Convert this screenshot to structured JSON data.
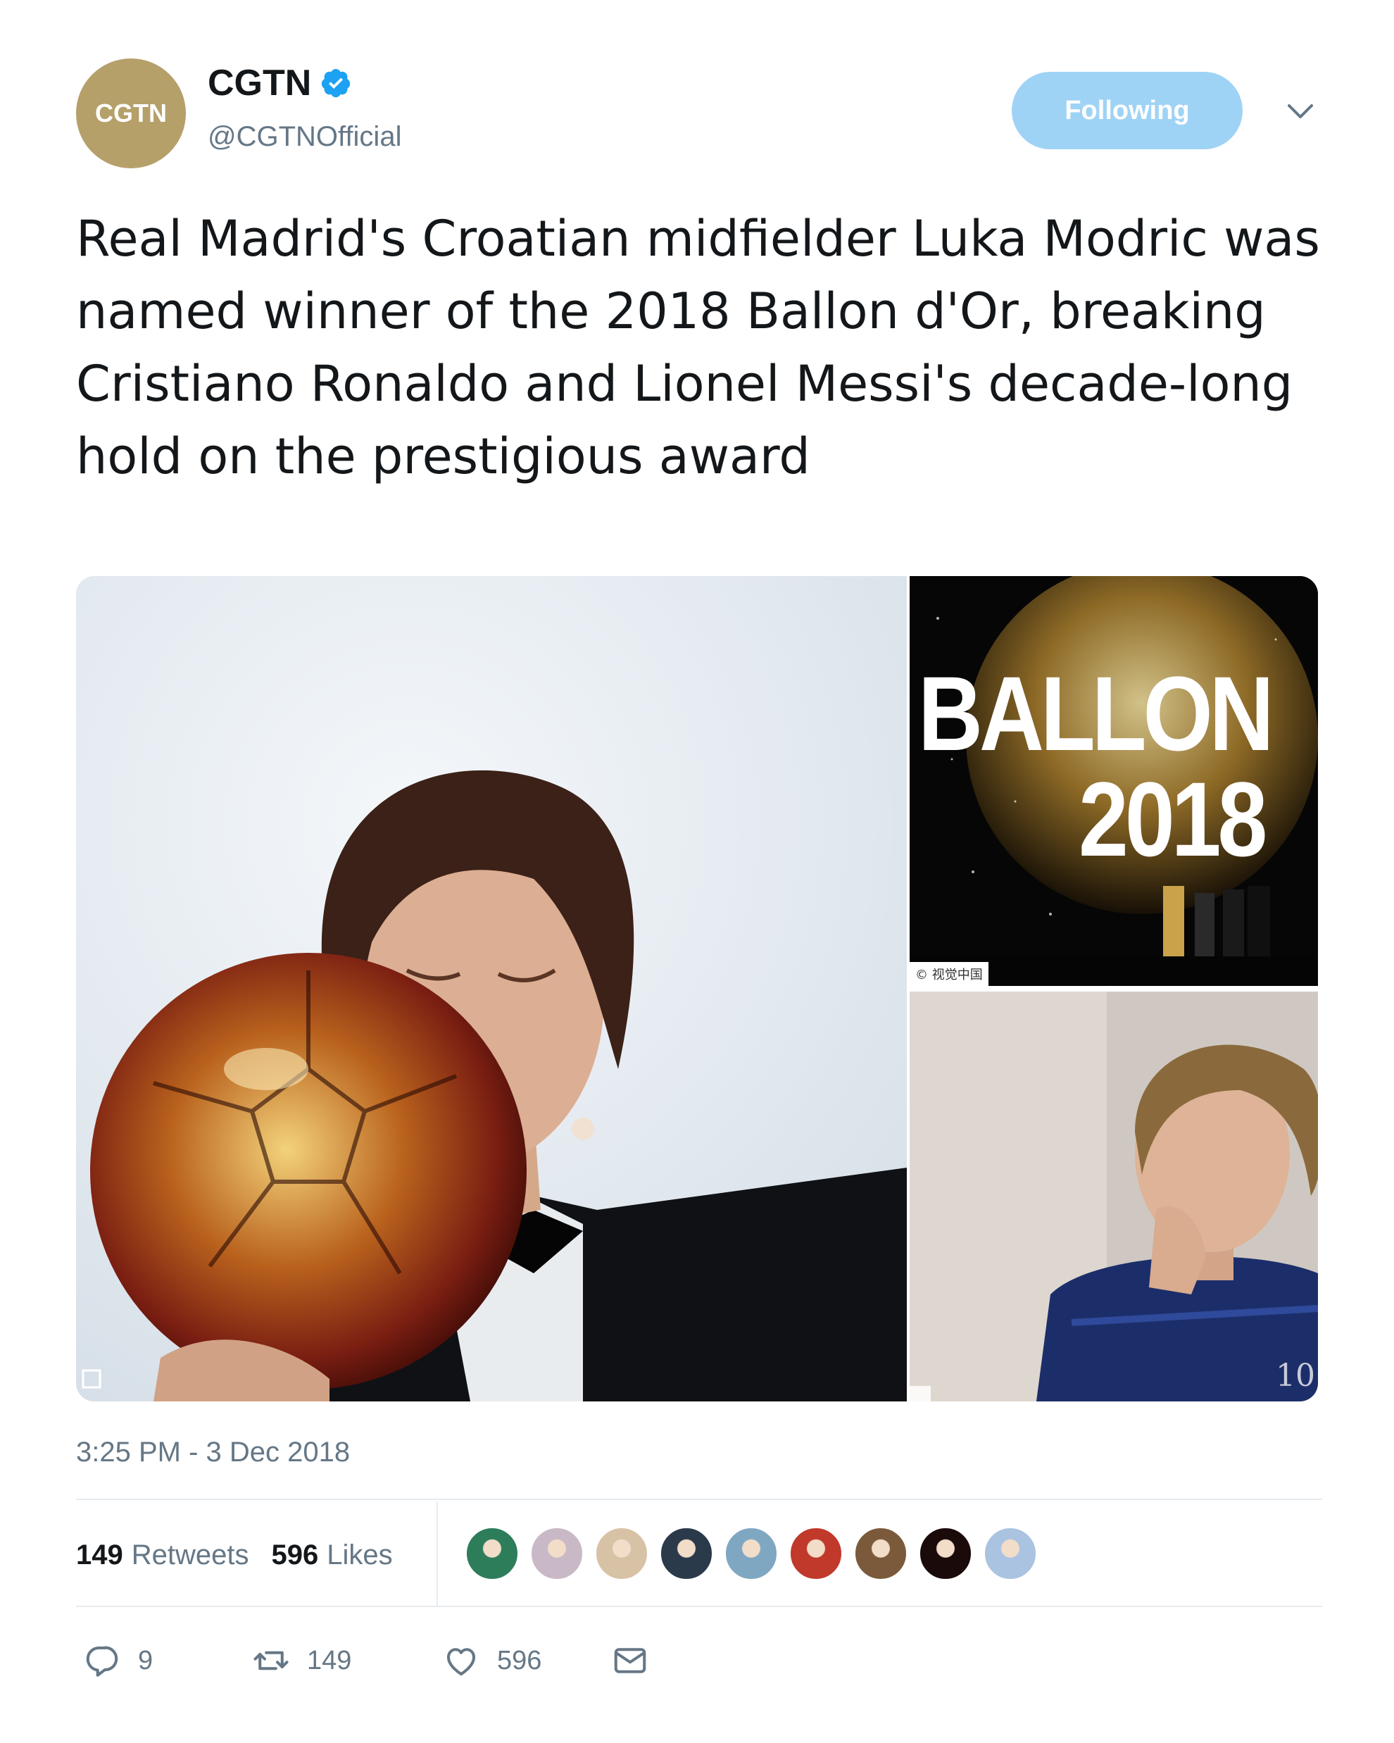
{
  "tweet": {
    "avatar_text": "CGTN",
    "display_name": "CGTN",
    "handle": "@CGTNOfficial",
    "follow_label": "Following",
    "text": "Real Madrid's Croatian midfielder Luka Modric was named winner of the 2018 Ballon d'Or, breaking Cristiano Ronaldo and Lionel Messi's decade-long hold on the prestigious award",
    "timestamp": "3:25 PM - 3 Dec 2018"
  },
  "media": {
    "top_right_title": "BALLON",
    "top_right_year": "2018",
    "top_right_credit": "© 视觉中国",
    "jersey_number": "10"
  },
  "stats": {
    "retweets_count": "149",
    "retweets_label": "Retweets",
    "likes_count": "596",
    "likes_label": "Likes",
    "liker_colors": [
      "#2e7d5a",
      "#c9b9c6",
      "#d8c2a6",
      "#2b3a4a",
      "#7fa7c2",
      "#c0392b",
      "#7a5a3a",
      "#1a0a0a",
      "#a9c3e0"
    ]
  },
  "actions": {
    "reply_count": "9",
    "retweet_count": "149",
    "like_count": "596"
  },
  "colors": {
    "accent": "#1da1f2",
    "follow_button": "#9fd3f6",
    "avatar": "#b6a06a",
    "muted_text": "#657786"
  }
}
